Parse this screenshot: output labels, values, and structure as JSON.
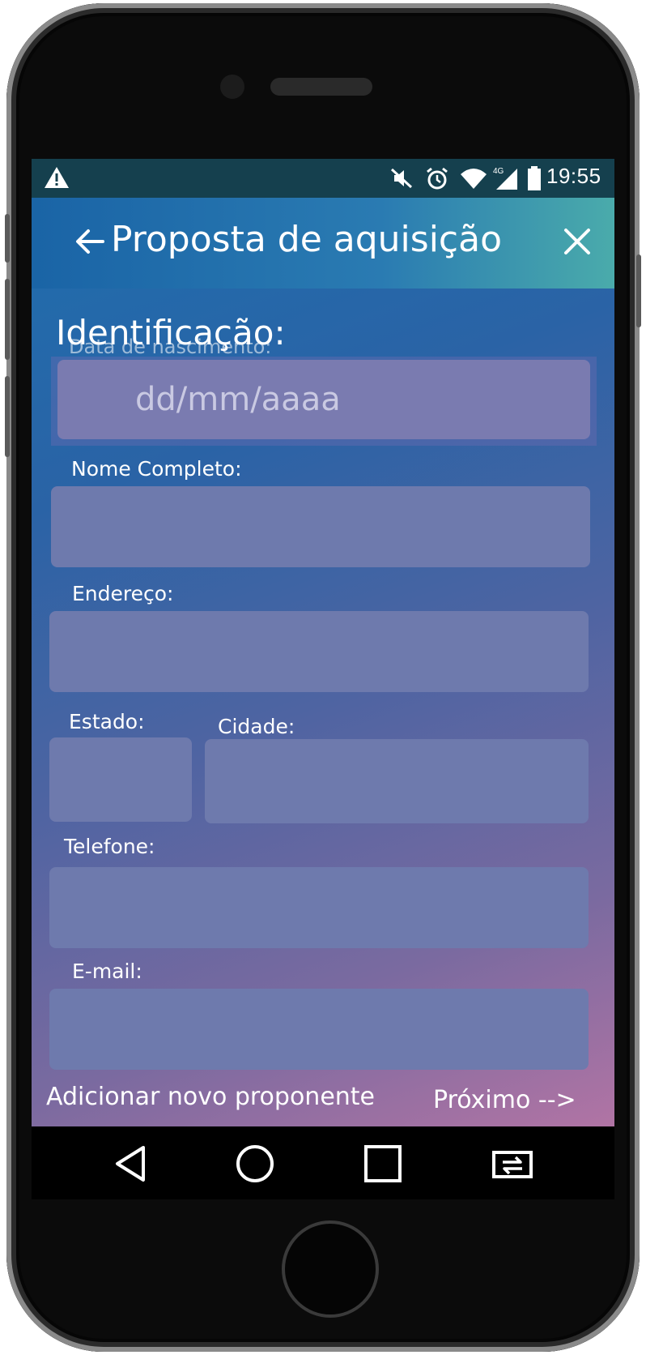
{
  "status_bar": {
    "time": "19:55",
    "network_label": "4G",
    "icons": [
      "warning-icon",
      "mute-icon",
      "alarm-icon",
      "wifi-icon",
      "signal-icon",
      "battery-icon"
    ]
  },
  "app_bar": {
    "title": "Proposta de aquisição",
    "back_icon": "arrow-left-icon",
    "close_icon": "close-icon"
  },
  "form": {
    "section_title": "Identificação:",
    "fields": {
      "birth_date": {
        "label": "Data de nascimento:",
        "placeholder": "dd/mm/aaaa",
        "value": ""
      },
      "full_name": {
        "label": "Nome Completo:",
        "value": ""
      },
      "address": {
        "label": "Endereço:",
        "value": ""
      },
      "state": {
        "label": "Estado:",
        "value": ""
      },
      "city": {
        "label": "Cidade:",
        "value": ""
      },
      "phone": {
        "label": "Telefone:",
        "value": ""
      },
      "email": {
        "label": "E-mail:",
        "value": ""
      }
    }
  },
  "actions": {
    "add_proponent": "Adicionar novo proponente",
    "next": "Próximo -->"
  },
  "nav_bar": {
    "icons": [
      "back-triangle-icon",
      "home-circle-icon",
      "recents-square-icon",
      "switch-app-icon"
    ]
  },
  "colors": {
    "status_bar": "#15404e",
    "app_bar_start": "#1a64a6",
    "app_bar_end": "#4aabab",
    "field_fill": "#6e7aad",
    "gradient_bottom": "#b174a4"
  }
}
